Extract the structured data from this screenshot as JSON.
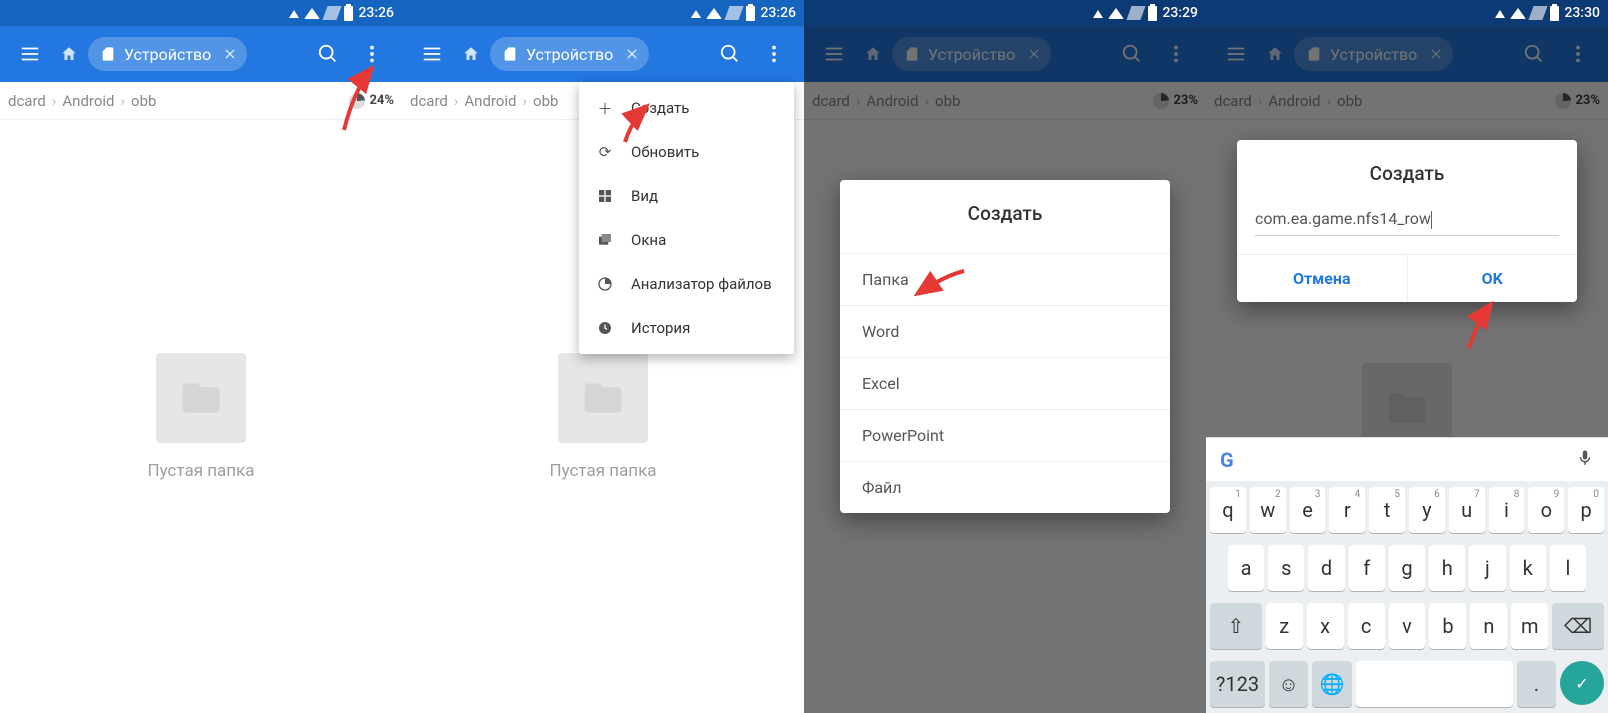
{
  "status": {
    "t1": "23:26",
    "t2": "23:26",
    "t3": "23:29",
    "t4": "23:30"
  },
  "chip": {
    "label": "Устройство"
  },
  "breadcrumb": {
    "b1": "dcard",
    "b2": "Android",
    "b3": "obb"
  },
  "storage": {
    "p1": "24%",
    "p2": "23%",
    "p3": "23%"
  },
  "empty": {
    "label": "Пустая папка"
  },
  "menu": {
    "create": "Создать",
    "refresh": "Обновить",
    "view": "Вид",
    "windows": "Окна",
    "analyzer": "Анализатор файлов",
    "history": "История"
  },
  "createDialog": {
    "title": "Создать",
    "folder": "Папка",
    "word": "Word",
    "excel": "Excel",
    "powerpoint": "PowerPoint",
    "file": "Файл"
  },
  "inputDialog": {
    "title": "Создать",
    "value": "com.ea.game.nfs14_row",
    "cancel": "Отмена",
    "ok": "OK"
  },
  "kb": {
    "r1": [
      "q",
      "w",
      "e",
      "r",
      "t",
      "y",
      "u",
      "i",
      "o",
      "p"
    ],
    "r1sup": [
      "1",
      "2",
      "3",
      "4",
      "5",
      "6",
      "7",
      "8",
      "9",
      "0"
    ],
    "r2": [
      "a",
      "s",
      "d",
      "f",
      "g",
      "h",
      "j",
      "k",
      "l"
    ],
    "r3": [
      "z",
      "x",
      "c",
      "v",
      "b",
      "n",
      "m"
    ],
    "sym": "?123",
    "comma": ",",
    "dot": "."
  }
}
